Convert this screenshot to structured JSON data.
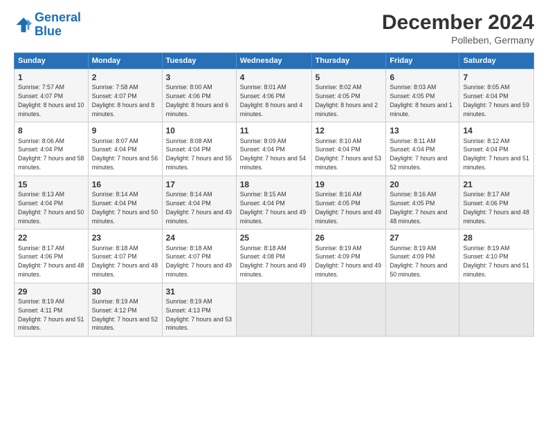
{
  "logo": {
    "line1": "General",
    "line2": "Blue"
  },
  "title": "December 2024",
  "subtitle": "Polleben, Germany",
  "weekdays": [
    "Sunday",
    "Monday",
    "Tuesday",
    "Wednesday",
    "Thursday",
    "Friday",
    "Saturday"
  ],
  "weeks": [
    [
      {
        "day": "1",
        "sunrise": "7:57 AM",
        "sunset": "4:07 PM",
        "daylight": "8 hours and 10 minutes."
      },
      {
        "day": "2",
        "sunrise": "7:58 AM",
        "sunset": "4:07 PM",
        "daylight": "8 hours and 8 minutes."
      },
      {
        "day": "3",
        "sunrise": "8:00 AM",
        "sunset": "4:06 PM",
        "daylight": "8 hours and 6 minutes."
      },
      {
        "day": "4",
        "sunrise": "8:01 AM",
        "sunset": "4:06 PM",
        "daylight": "8 hours and 4 minutes."
      },
      {
        "day": "5",
        "sunrise": "8:02 AM",
        "sunset": "4:05 PM",
        "daylight": "8 hours and 2 minutes."
      },
      {
        "day": "6",
        "sunrise": "8:03 AM",
        "sunset": "4:05 PM",
        "daylight": "8 hours and 1 minute."
      },
      {
        "day": "7",
        "sunrise": "8:05 AM",
        "sunset": "4:04 PM",
        "daylight": "7 hours and 59 minutes."
      }
    ],
    [
      {
        "day": "8",
        "sunrise": "8:06 AM",
        "sunset": "4:04 PM",
        "daylight": "7 hours and 58 minutes."
      },
      {
        "day": "9",
        "sunrise": "8:07 AM",
        "sunset": "4:04 PM",
        "daylight": "7 hours and 56 minutes."
      },
      {
        "day": "10",
        "sunrise": "8:08 AM",
        "sunset": "4:04 PM",
        "daylight": "7 hours and 55 minutes."
      },
      {
        "day": "11",
        "sunrise": "8:09 AM",
        "sunset": "4:04 PM",
        "daylight": "7 hours and 54 minutes."
      },
      {
        "day": "12",
        "sunrise": "8:10 AM",
        "sunset": "4:04 PM",
        "daylight": "7 hours and 53 minutes."
      },
      {
        "day": "13",
        "sunrise": "8:11 AM",
        "sunset": "4:04 PM",
        "daylight": "7 hours and 52 minutes."
      },
      {
        "day": "14",
        "sunrise": "8:12 AM",
        "sunset": "4:04 PM",
        "daylight": "7 hours and 51 minutes."
      }
    ],
    [
      {
        "day": "15",
        "sunrise": "8:13 AM",
        "sunset": "4:04 PM",
        "daylight": "7 hours and 50 minutes."
      },
      {
        "day": "16",
        "sunrise": "8:14 AM",
        "sunset": "4:04 PM",
        "daylight": "7 hours and 50 minutes."
      },
      {
        "day": "17",
        "sunrise": "8:14 AM",
        "sunset": "4:04 PM",
        "daylight": "7 hours and 49 minutes."
      },
      {
        "day": "18",
        "sunrise": "8:15 AM",
        "sunset": "4:04 PM",
        "daylight": "7 hours and 49 minutes."
      },
      {
        "day": "19",
        "sunrise": "8:16 AM",
        "sunset": "4:05 PM",
        "daylight": "7 hours and 49 minutes."
      },
      {
        "day": "20",
        "sunrise": "8:16 AM",
        "sunset": "4:05 PM",
        "daylight": "7 hours and 48 minutes."
      },
      {
        "day": "21",
        "sunrise": "8:17 AM",
        "sunset": "4:06 PM",
        "daylight": "7 hours and 48 minutes."
      }
    ],
    [
      {
        "day": "22",
        "sunrise": "8:17 AM",
        "sunset": "4:06 PM",
        "daylight": "7 hours and 48 minutes."
      },
      {
        "day": "23",
        "sunrise": "8:18 AM",
        "sunset": "4:07 PM",
        "daylight": "7 hours and 48 minutes."
      },
      {
        "day": "24",
        "sunrise": "8:18 AM",
        "sunset": "4:07 PM",
        "daylight": "7 hours and 49 minutes."
      },
      {
        "day": "25",
        "sunrise": "8:18 AM",
        "sunset": "4:08 PM",
        "daylight": "7 hours and 49 minutes."
      },
      {
        "day": "26",
        "sunrise": "8:19 AM",
        "sunset": "4:09 PM",
        "daylight": "7 hours and 49 minutes."
      },
      {
        "day": "27",
        "sunrise": "8:19 AM",
        "sunset": "4:09 PM",
        "daylight": "7 hours and 50 minutes."
      },
      {
        "day": "28",
        "sunrise": "8:19 AM",
        "sunset": "4:10 PM",
        "daylight": "7 hours and 51 minutes."
      }
    ],
    [
      {
        "day": "29",
        "sunrise": "8:19 AM",
        "sunset": "4:11 PM",
        "daylight": "7 hours and 51 minutes."
      },
      {
        "day": "30",
        "sunrise": "8:19 AM",
        "sunset": "4:12 PM",
        "daylight": "7 hours and 52 minutes."
      },
      {
        "day": "31",
        "sunrise": "8:19 AM",
        "sunset": "4:13 PM",
        "daylight": "7 hours and 53 minutes."
      },
      null,
      null,
      null,
      null
    ]
  ],
  "labels": {
    "sunrise": "Sunrise:",
    "sunset": "Sunset:",
    "daylight": "Daylight:"
  }
}
